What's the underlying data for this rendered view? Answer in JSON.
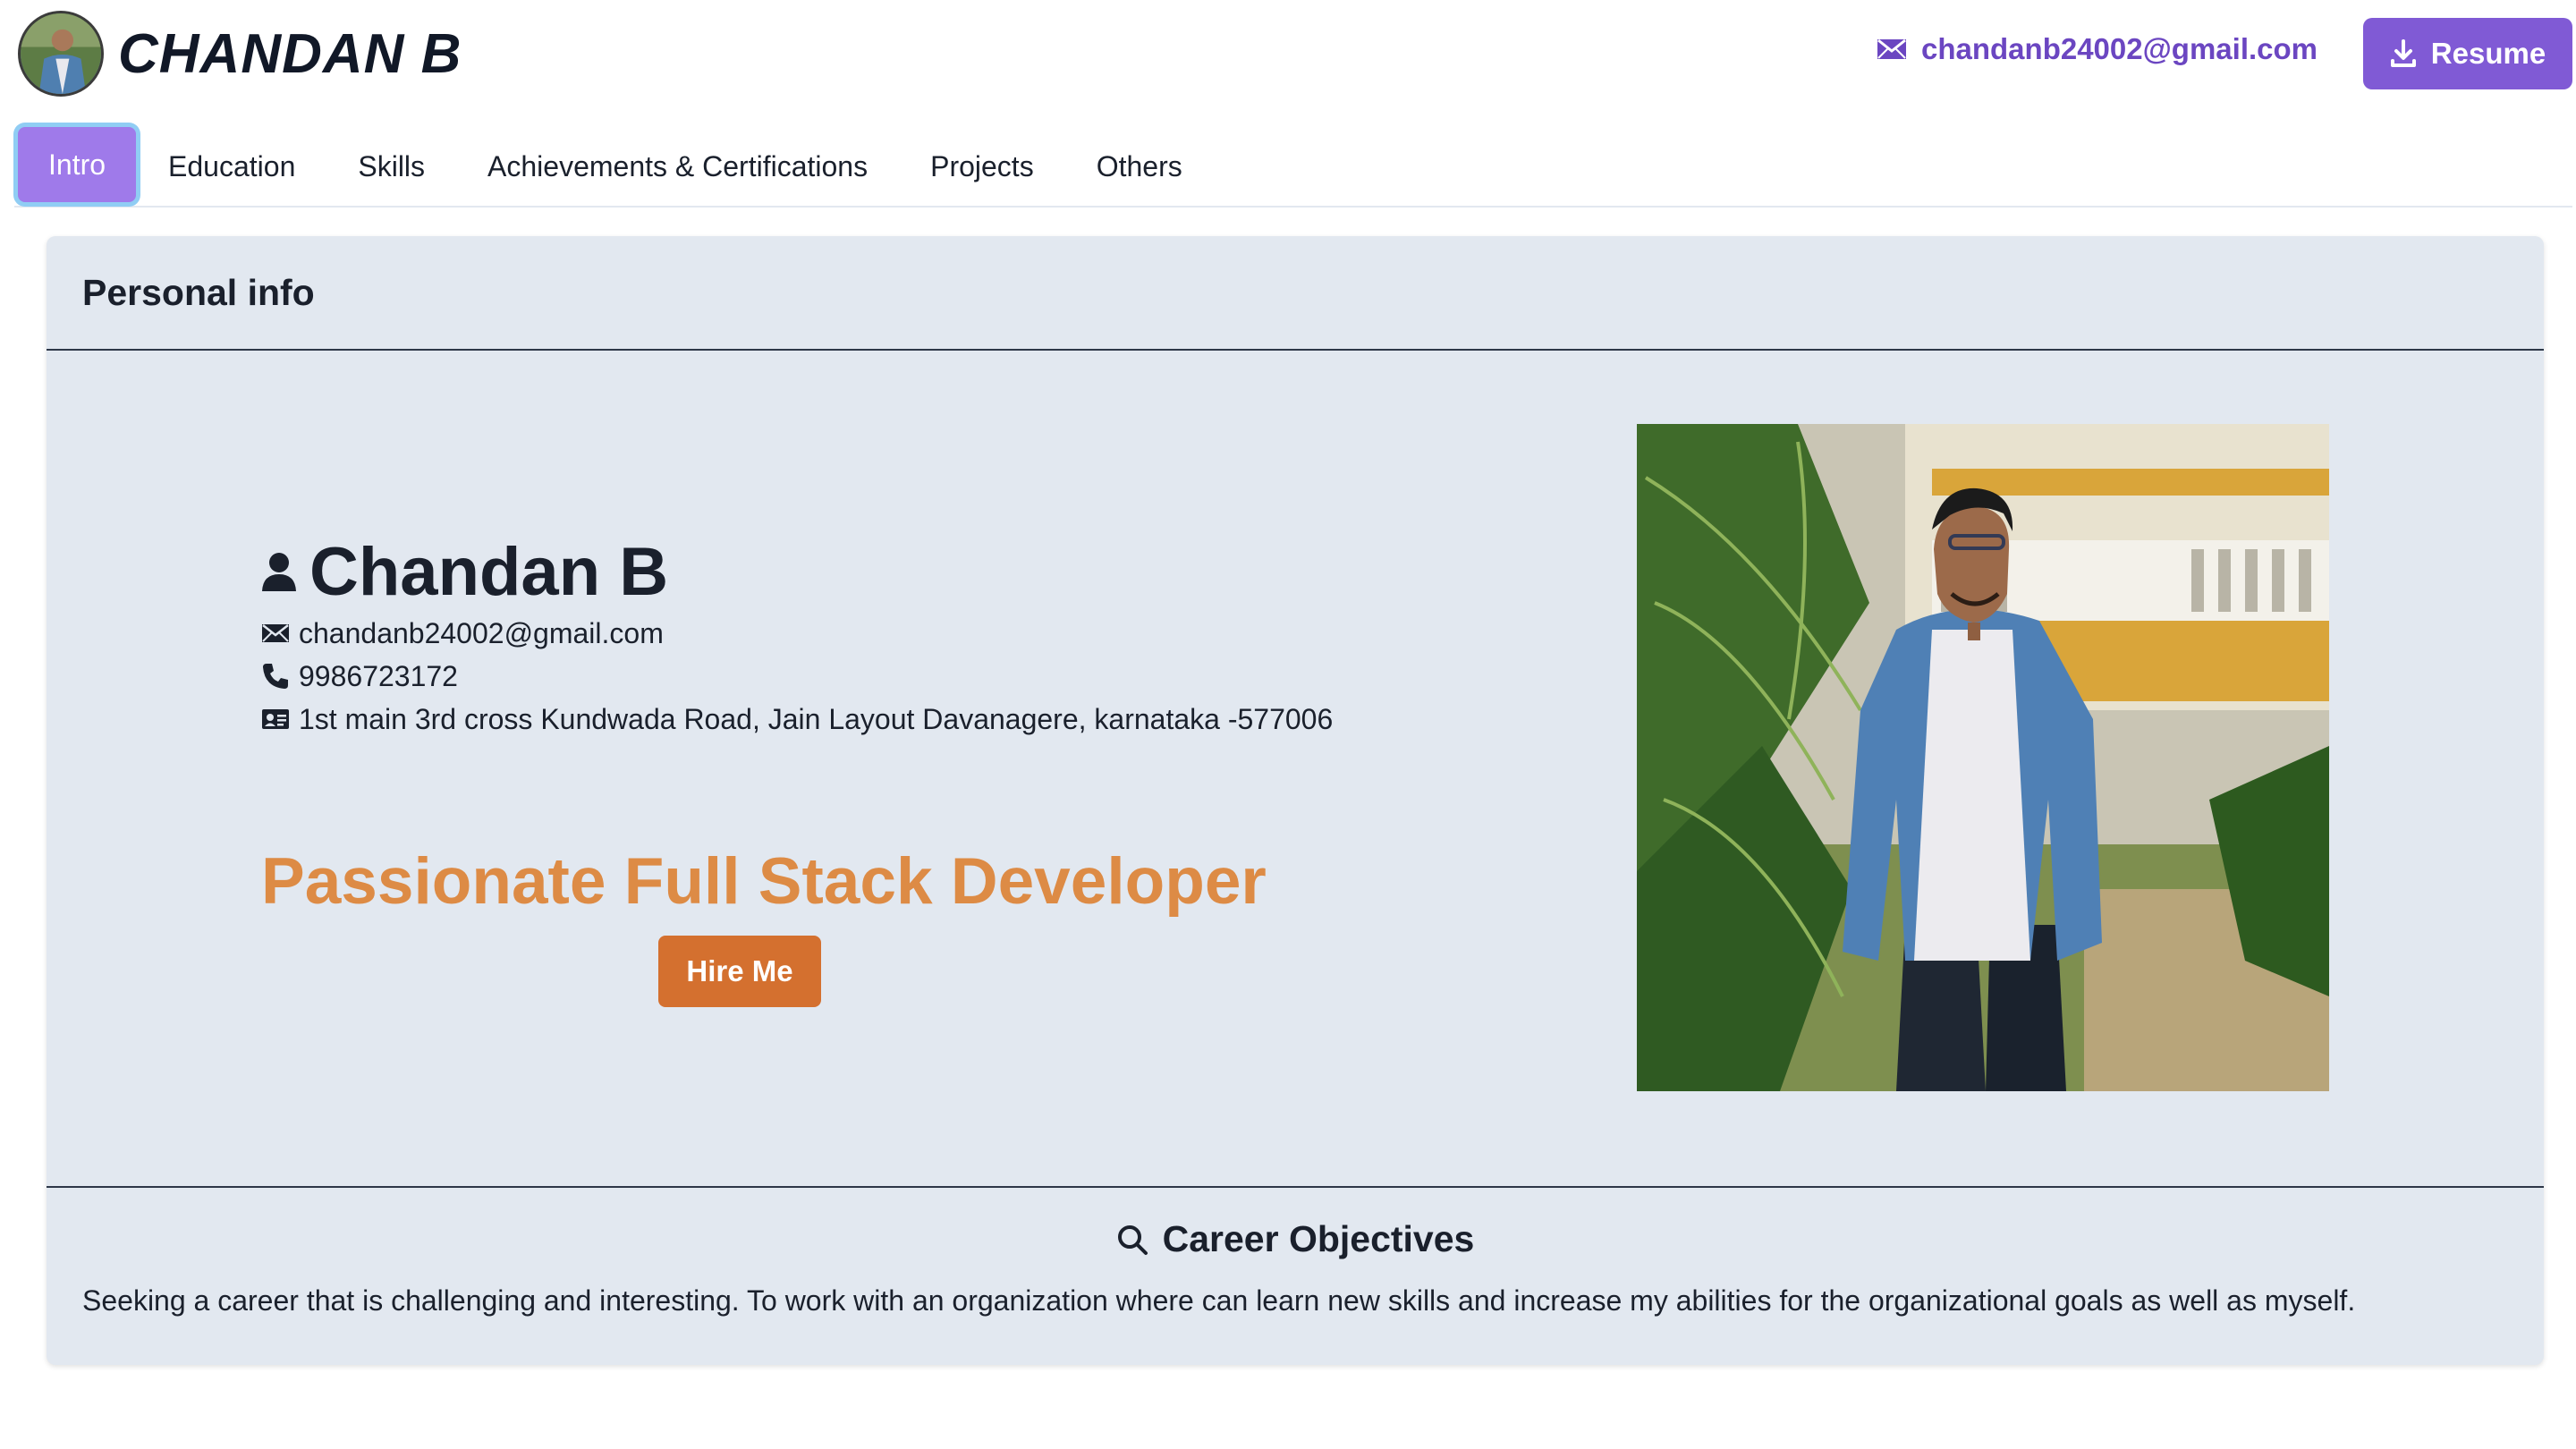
{
  "header": {
    "brand_name": "CHANDAN B",
    "email": "chandanb24002@gmail.com",
    "resume_label": "Resume"
  },
  "tabs": [
    {
      "label": "Intro",
      "active": true
    },
    {
      "label": "Education"
    },
    {
      "label": "Skills"
    },
    {
      "label": "Achievements & Certifications"
    },
    {
      "label": "Projects"
    },
    {
      "label": "Others"
    }
  ],
  "personal": {
    "section_title": "Personal info",
    "name": "Chandan B",
    "email": "chandanb24002@gmail.com",
    "phone": "9986723172",
    "address": "1st main 3rd cross Kundwada Road, Jain Layout Davanagere, karnataka -577006",
    "tagline": "Passionate Full Stack Developer",
    "hire_label": "Hire Me"
  },
  "career": {
    "title": "Career Objectives",
    "text": "Seeking a career that is challenging and interesting. To work with an organization where can learn new skills and increase my abilities for the organizational goals as well as myself."
  },
  "colors": {
    "accent": "#805ad5",
    "tab_active": "#9f7aea",
    "tagline": "#dd8b45",
    "hire_button": "#d4702f",
    "card_bg": "#e2e8f0"
  },
  "icons": {
    "header_email": "envelope-icon",
    "resume": "download-icon",
    "name": "user-icon",
    "email": "envelope-icon",
    "phone": "phone-icon",
    "address": "id-card-icon",
    "career": "search-icon"
  }
}
